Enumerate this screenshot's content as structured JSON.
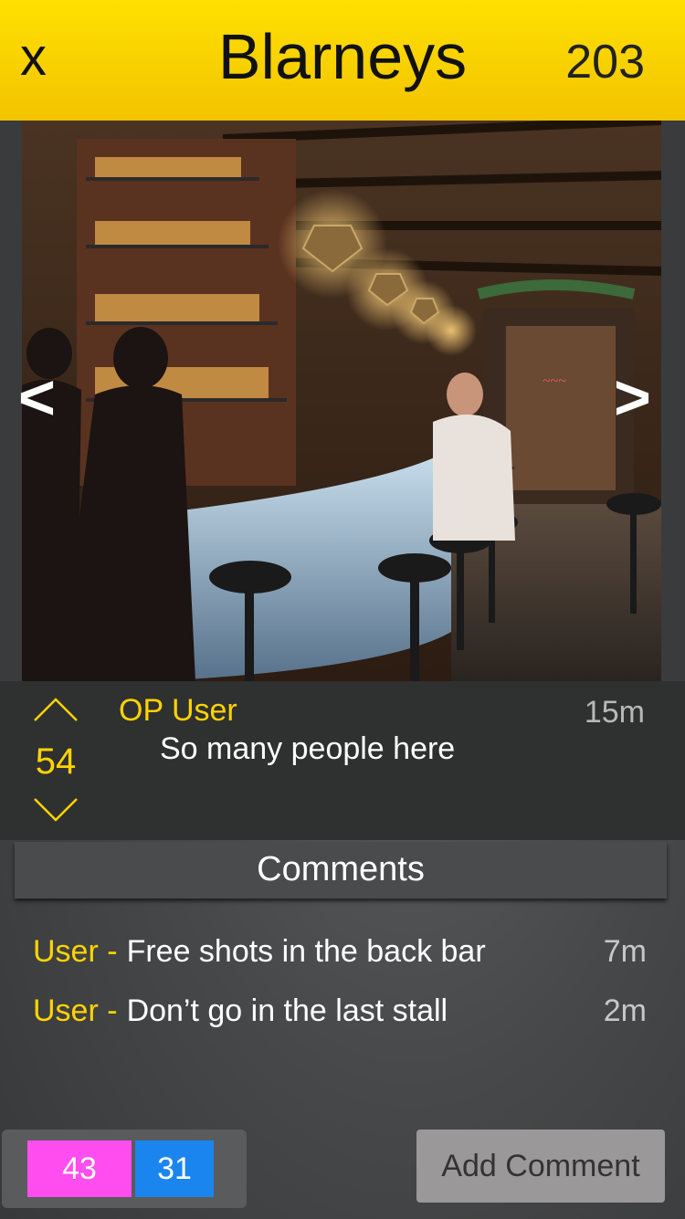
{
  "header": {
    "close_label": "x",
    "title": "Blarneys",
    "count": "203"
  },
  "photo": {
    "prev_label": "<",
    "next_label": ">"
  },
  "post": {
    "score": "54",
    "user": "OP User",
    "text": "So many people here",
    "time": "15m"
  },
  "comments": {
    "header": "Comments",
    "items": [
      {
        "user": "User -",
        "text": "Free shots in the back bar",
        "time": "7m"
      },
      {
        "user": "User -",
        "text": "Don’t go in the last stall",
        "time": "2m"
      }
    ]
  },
  "footer": {
    "badge_pink": "43",
    "badge_blue": "31",
    "add_comment_label": "Add Comment"
  },
  "colors": {
    "header_yellow": "#ffe000",
    "accent_yellow": "#ffd400",
    "badge_pink": "#ff4df0",
    "badge_blue": "#1a85ee"
  }
}
